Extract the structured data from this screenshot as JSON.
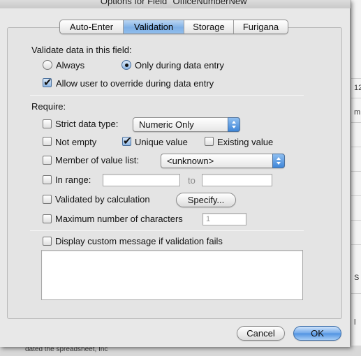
{
  "window": {
    "title": "Options for Field \"OfficeNumberNew\""
  },
  "tabs": [
    {
      "label": "Auto-Enter",
      "selected": false
    },
    {
      "label": "Validation",
      "selected": true
    },
    {
      "label": "Storage",
      "selected": false
    },
    {
      "label": "Furigana",
      "selected": false
    }
  ],
  "validate": {
    "heading": "Validate data in this field:",
    "always_label": "Always",
    "always_selected": false,
    "during_entry_label": "Only during data entry",
    "during_entry_selected": true,
    "override_label": "Allow user to override during data entry",
    "override_checked": true
  },
  "require": {
    "heading": "Require:",
    "strict_type_label": "Strict data type:",
    "strict_type_checked": false,
    "strict_type_value": "Numeric Only",
    "not_empty_label": "Not empty",
    "not_empty_checked": false,
    "unique_label": "Unique value",
    "unique_checked": true,
    "existing_label": "Existing value",
    "existing_checked": false,
    "value_list_label": "Member of value list:",
    "value_list_checked": false,
    "value_list_value": "<unknown>",
    "range_label": "In range:",
    "range_checked": false,
    "range_from": "",
    "range_to_label": "to",
    "range_to": "",
    "calc_label": "Validated by calculation",
    "calc_checked": false,
    "specify_button": "Specify...",
    "max_chars_label": "Maximum number of characters",
    "max_chars_checked": false,
    "max_chars_value": "1"
  },
  "custom_message": {
    "label": "Display custom message if validation fails",
    "checked": false,
    "text": ""
  },
  "buttons": {
    "cancel": "Cancel",
    "ok": "OK"
  },
  "background": {
    "bottom_text": "dated the spreadsheet, Inc",
    "edge_glyphs": [
      "12",
      "m",
      "S",
      "l"
    ]
  },
  "colors": {
    "accent": "#6fa8ea",
    "dialog_bg": "#e8e8e8"
  }
}
